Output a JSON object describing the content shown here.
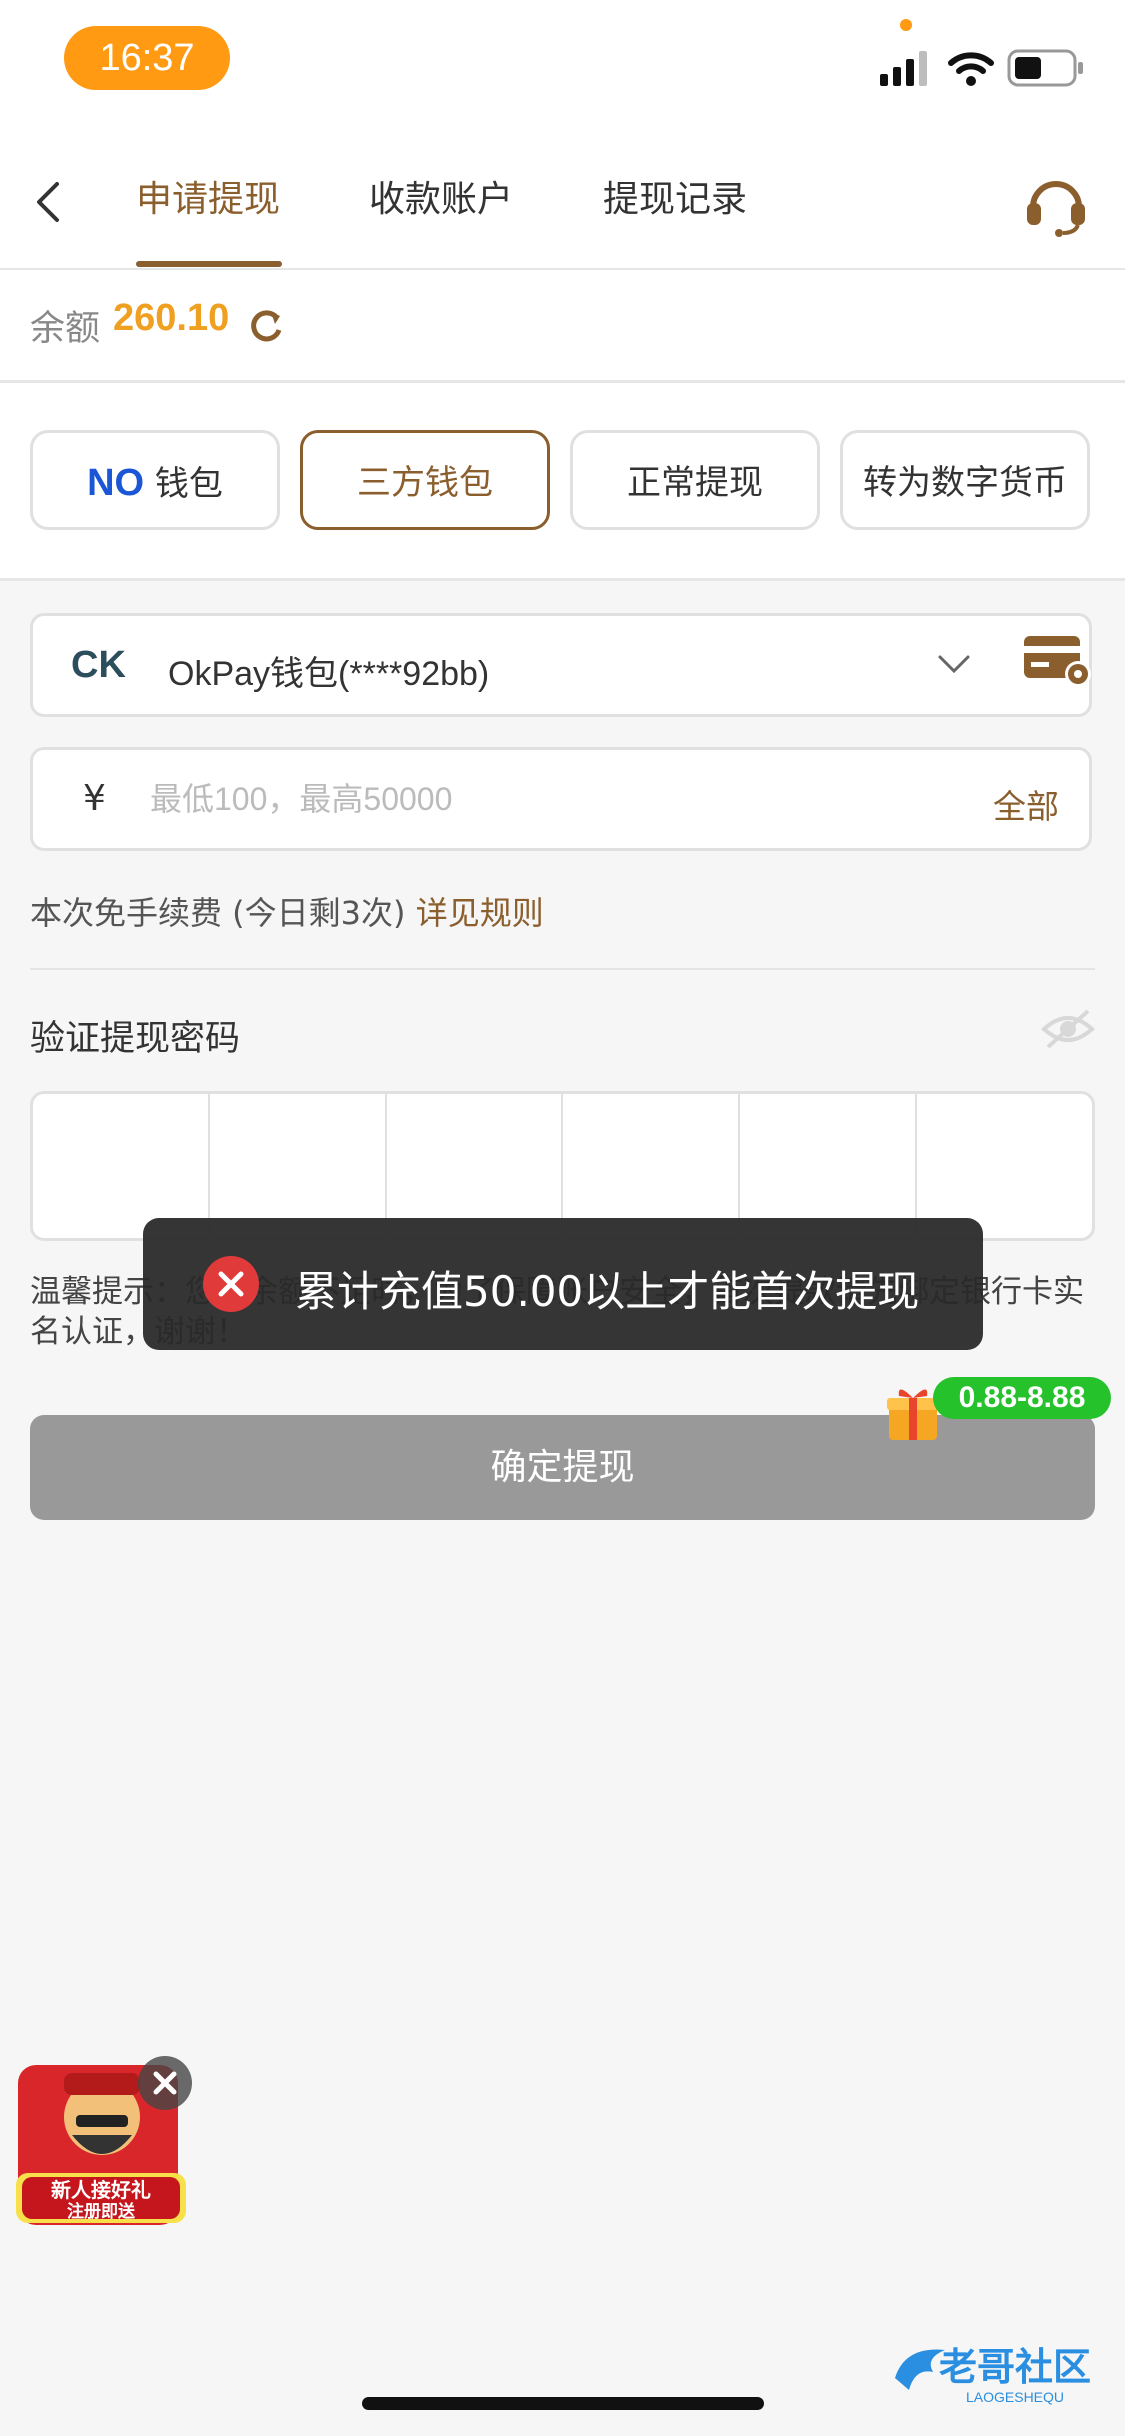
{
  "status_bar": {
    "time": "16:37"
  },
  "tabs": [
    {
      "label": "申请提现",
      "active": true
    },
    {
      "label": "收款账户",
      "active": false
    },
    {
      "label": "提现记录",
      "active": false
    }
  ],
  "balance": {
    "label": "余额",
    "value": "260.10"
  },
  "methods": [
    {
      "logo": "NO",
      "label": "钱包"
    },
    {
      "label": "三方钱包",
      "active": true
    },
    {
      "label": "正常提现"
    },
    {
      "label": "转为数字货币"
    }
  ],
  "wallet": {
    "name": "OkPay钱包(****92bb)",
    "logo": "CK"
  },
  "amount": {
    "currency": "¥",
    "placeholder": "最低100，最高50000",
    "all_label": "全部"
  },
  "fee": {
    "text": "本次免手续费 (今日剩3次)",
    "link": "详见规则"
  },
  "password": {
    "label": "验证提现密码"
  },
  "tip": {
    "text": "温馨提示：您的余额不足时，为了保障账户安全，首次提款请先绑定银行卡实名认证，谢谢！"
  },
  "submit": {
    "label": "确定提现"
  },
  "toast": {
    "text": "累计充值50.00以上才能首次提现"
  },
  "gift_badge": {
    "text": "0.88-8.88"
  },
  "promo": {
    "line1": "新人接好礼",
    "line2": "注册即送"
  },
  "watermark": {
    "text": "老哥社区",
    "subtext": "LAOGESHEQU"
  },
  "colors": {
    "accent": "#8b5e2d",
    "balance": "#f0a020",
    "time_pill": "#ff9a12",
    "toast_icon": "#e03a3a",
    "badge": "#26c22c"
  }
}
